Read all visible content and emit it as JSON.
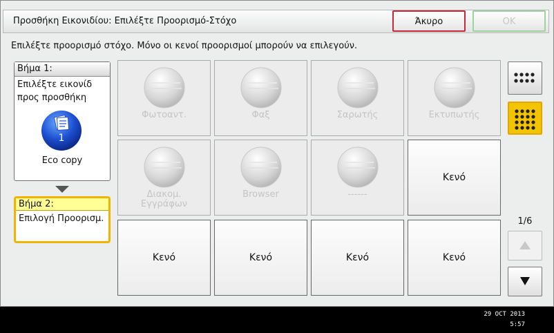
{
  "title": "Προσθήκη Εικονιδίου: Επιλέξτε Προορισμό-Στόχο",
  "buttons": {
    "cancel": "Άκυρο",
    "ok": "OK"
  },
  "instruction": "Επιλέξτε προορισμό στόχο. Μόνο οι κενοί προορισμοί μπορούν να επιλεγούν.",
  "step1": {
    "heading": "Βήμα 1:",
    "line1": "Επιλέξτε εικονίδ",
    "line2": "προς προσθήκη",
    "badge_number": "1",
    "item_name": "Eco copy"
  },
  "step2": {
    "heading": "Βήμα 2:",
    "text": "Επιλογή Προορισμ."
  },
  "grid": {
    "row1": [
      "Φωτοαντ.",
      "Φαξ",
      "Σαρωτής",
      "Εκτυπωτής"
    ],
    "row2": [
      "Διακομ.",
      "Εγγράφων",
      "Browser",
      "------",
      "Κενό"
    ],
    "row3": [
      "Κενό",
      "Κενό",
      "Κενό",
      "Κενό"
    ]
  },
  "page_indicator": "1/6",
  "clock": {
    "date": "29 OCT  2013",
    "time": "5:57"
  },
  "colors": {
    "cancel_border": "#c6283a",
    "ok_border": "#9ed3a0",
    "step2_highlight": "#f0b400",
    "grid_selected": "#f5c400"
  }
}
